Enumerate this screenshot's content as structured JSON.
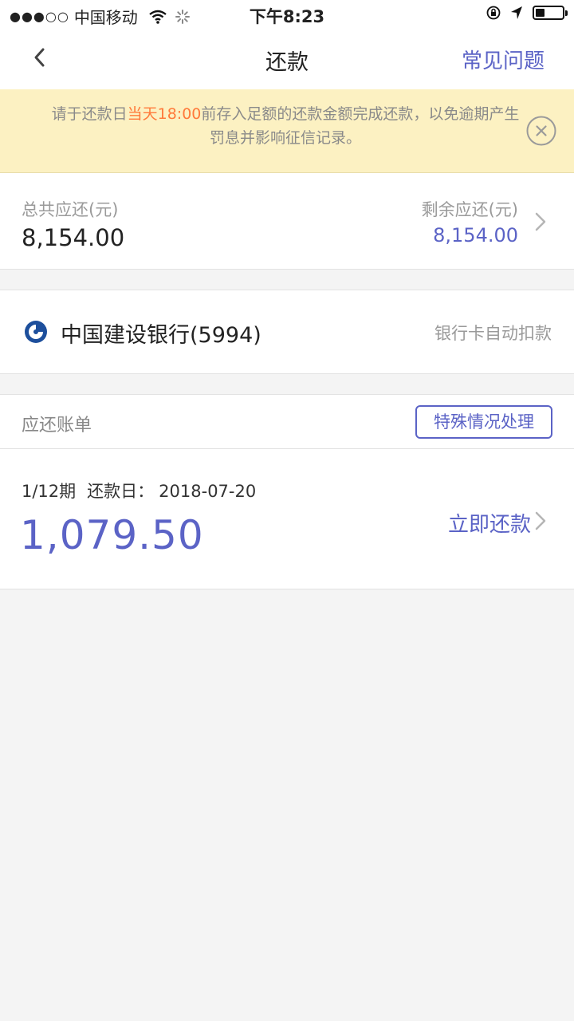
{
  "status_bar": {
    "signal": "●●●○○",
    "carrier": "中国移动",
    "time": "下午8:23",
    "battery_level": 0.35
  },
  "nav": {
    "back_icon": "chevron-left-icon",
    "title": "还款",
    "faq": "常见问题"
  },
  "notice": {
    "text_before": "请于还款日",
    "highlight": "当天18:00",
    "text_after": "前存入足额的还款金额完成还款，以免逾期产生罚息并影响征信记录。",
    "highlight_color": "#ff7a3a",
    "close_icon": "close-circle-icon"
  },
  "summary": {
    "total_label": "总共应还(元)",
    "total_value": "8,154.00",
    "remaining_label": "剩余应还(元)",
    "remaining_value": "8,154.00"
  },
  "bank": {
    "name": "中国建设银行(5994)",
    "mode": "银行卡自动扣款",
    "logo_icon": "ccb-logo-icon"
  },
  "bills": {
    "title": "应还账单",
    "special_button": "特殊情况处理",
    "items": [
      {
        "period": "1/12期",
        "due_label": "还款日：",
        "due_date": "2018-07-20",
        "amount": "1,079.50",
        "pay_label": "立即还款"
      }
    ]
  },
  "colors": {
    "accent": "#5b63c6",
    "notice_bg": "#fcf1c2",
    "page_bg": "#f4f4f4"
  }
}
